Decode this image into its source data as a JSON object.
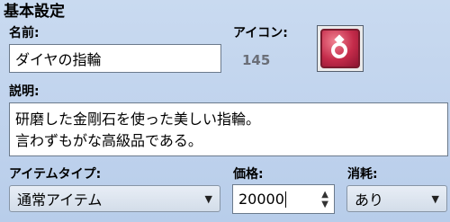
{
  "section": {
    "title": "基本設定"
  },
  "name": {
    "label": "名前:",
    "value": "ダイヤの指輪"
  },
  "icon": {
    "label": "アイコン:",
    "index": "145",
    "icon_name": "ring-icon"
  },
  "description": {
    "label": "説明:",
    "lines": [
      "研磨した金剛石を使った美しい指輪。",
      "言わずもがな高級品である。"
    ]
  },
  "item_type": {
    "label": "アイテムタイプ:",
    "selected": "通常アイテム"
  },
  "price": {
    "label": "価格:",
    "value": "20000"
  },
  "consumable": {
    "label": "消耗:",
    "selected": "あり"
  }
}
